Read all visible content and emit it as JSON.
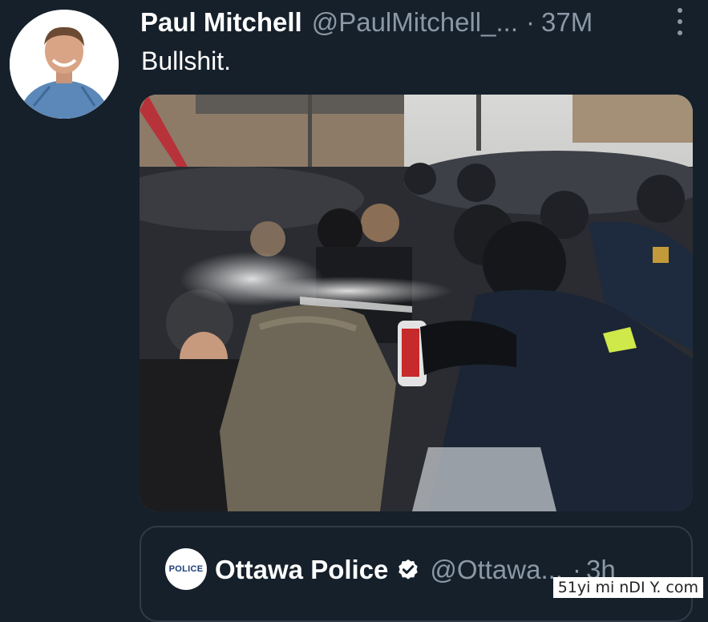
{
  "tweet": {
    "display_name": "Paul Mitchell",
    "handle": "@PaulMitchell_...",
    "separator": "·",
    "time": "37M",
    "text": "Bullshit.",
    "more_icon": "more-vertical-icon",
    "avatar_icon": "profile-photo"
  },
  "media": {
    "kind": "photo"
  },
  "quoted_tweet": {
    "avatar_text": "POLICE",
    "display_name": "Ottawa Police",
    "verified_icon": "verified-badge-icon",
    "handle": "@Ottawa...",
    "separator": "·",
    "time": "3h"
  },
  "watermark": {
    "text": "51yi mi nDI Y. com"
  },
  "colors": {
    "background": "#15202b",
    "primary_text": "#ffffff",
    "secondary_text": "#8b98a5",
    "border": "#2f3b47"
  }
}
